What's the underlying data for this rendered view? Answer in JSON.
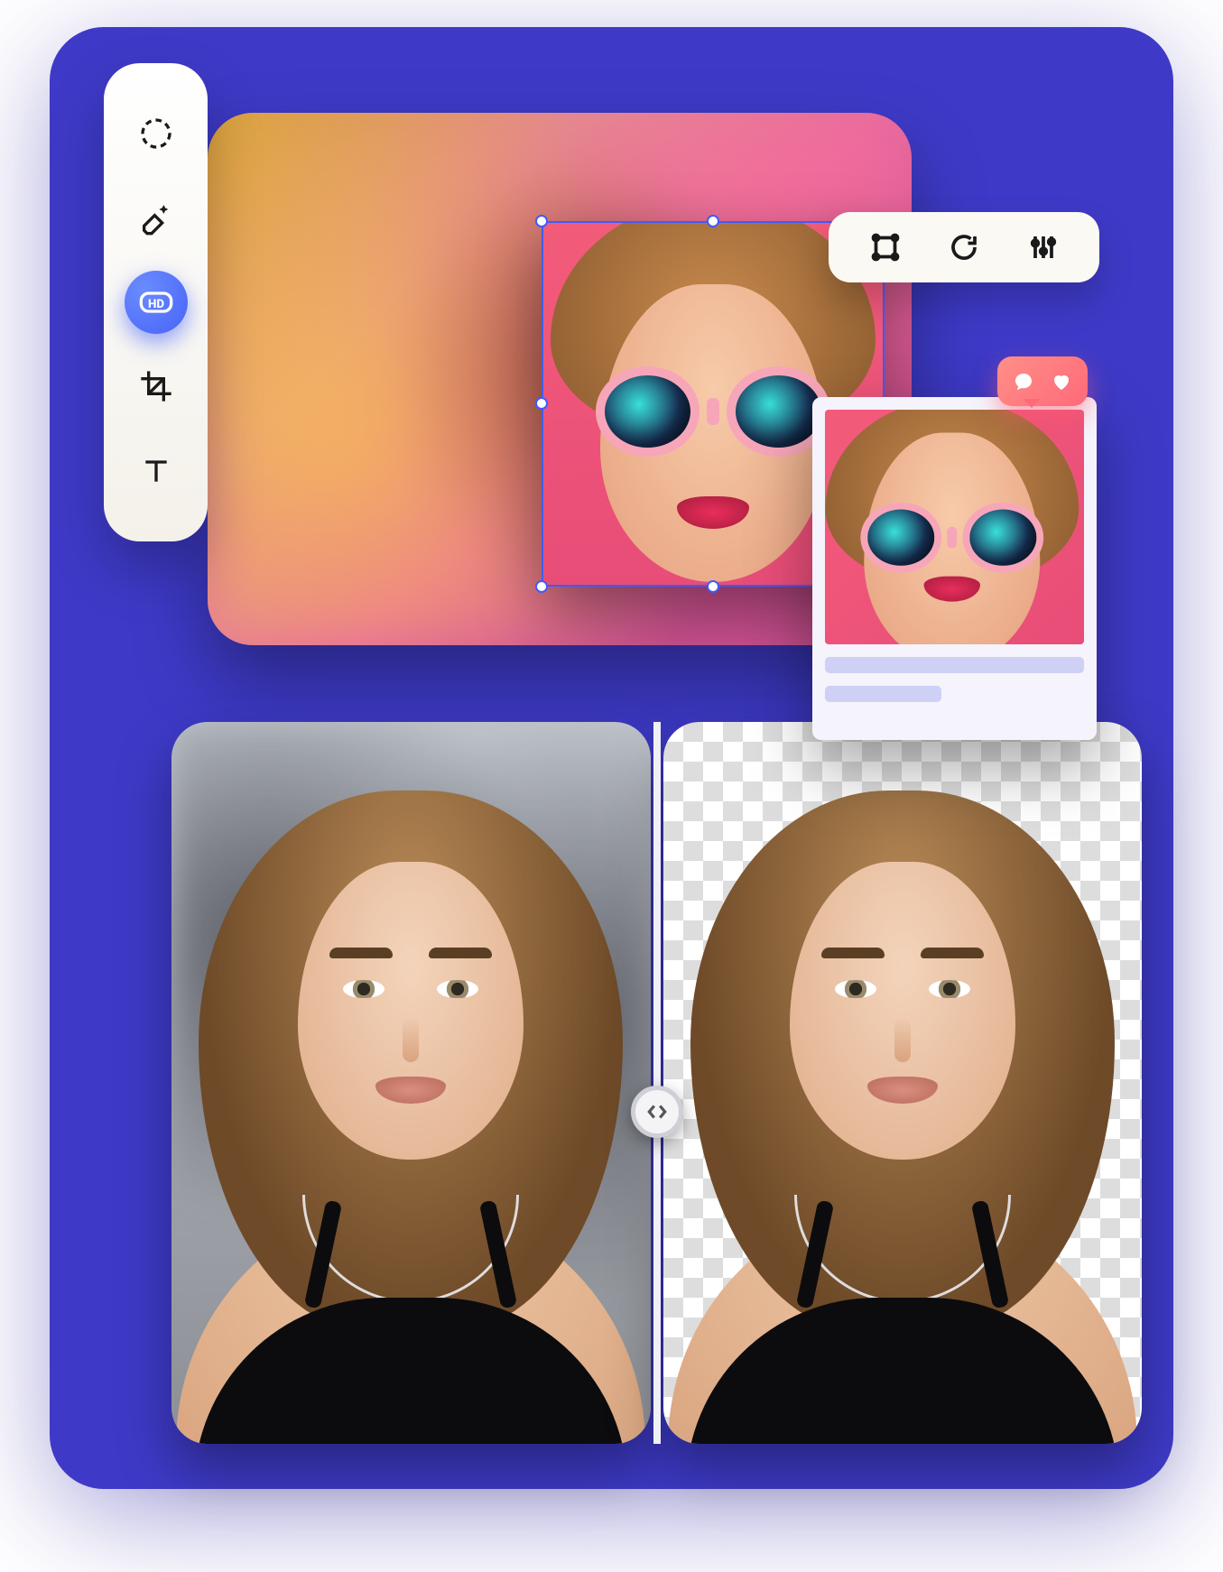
{
  "toolbar_left": {
    "items": [
      {
        "name": "select-tool",
        "icon": "dashed-circle-icon",
        "active": false
      },
      {
        "name": "eraser-tool",
        "icon": "eraser-sparkle-icon",
        "active": false
      },
      {
        "name": "enhance-tool",
        "icon": "hd-badge-icon",
        "active": true,
        "badge_text": "HD"
      },
      {
        "name": "crop-tool",
        "icon": "crop-icon",
        "active": false
      },
      {
        "name": "text-tool",
        "icon": "text-icon",
        "active": false
      }
    ]
  },
  "toolbar_right": {
    "items": [
      {
        "name": "bounding-box-tool",
        "icon": "bounding-box-icon"
      },
      {
        "name": "rotate-tool",
        "icon": "rotate-icon"
      },
      {
        "name": "adjust-tool",
        "icon": "sliders-icon"
      }
    ]
  },
  "canvas": {
    "selection": {
      "has_selection": true,
      "handles": 8
    }
  },
  "social_preview": {
    "reactions": [
      "comment",
      "like"
    ],
    "caption_lines": 2
  },
  "comparison": {
    "left_label": "original",
    "right_label": "background-removed",
    "slider_position_percent": 50
  },
  "colors": {
    "stage_bg": "#3E3AC7",
    "accent_blue": "#4763F7",
    "selection_border": "#3F5BFF",
    "bubble_gradient_from": "#ff8f87",
    "bubble_gradient_to": "#ff6a7a"
  }
}
